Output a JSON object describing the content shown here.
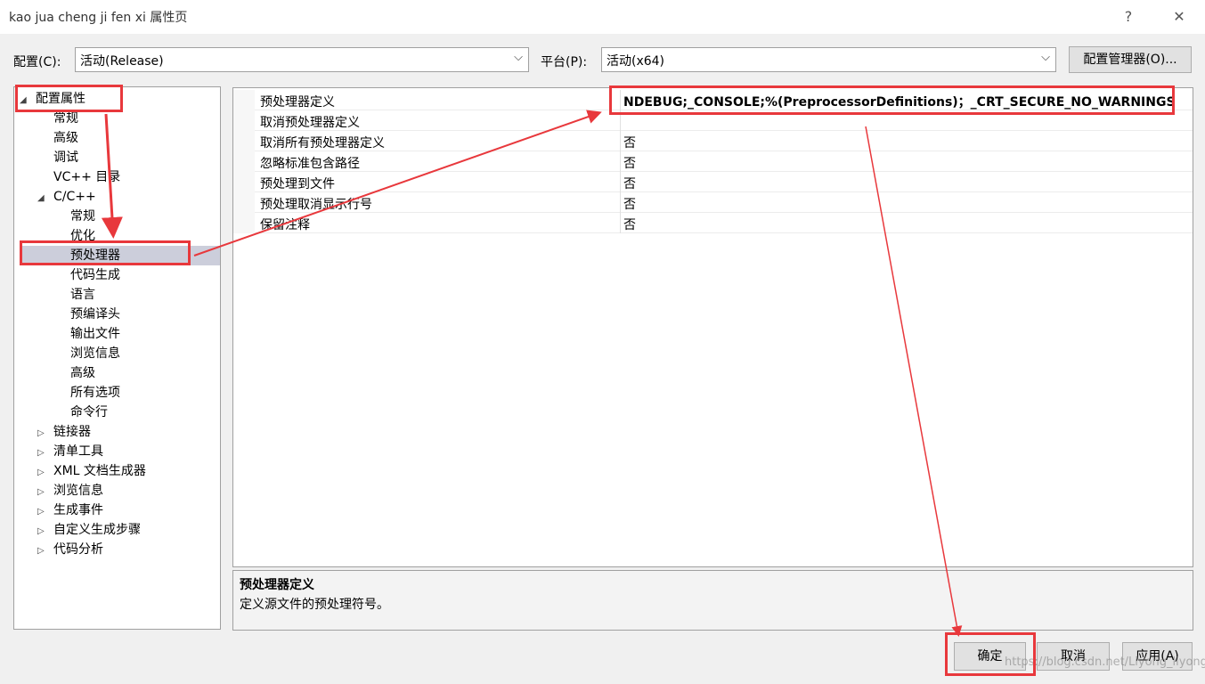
{
  "window": {
    "title": "kao jua cheng ji fen xi 属性页",
    "help": "?",
    "close": "✕"
  },
  "toolbar": {
    "config_label": "配置(C):",
    "config_value": "活动(Release)",
    "platform_label": "平台(P):",
    "platform_value": "活动(x64)",
    "config_manager": "配置管理器(O)..."
  },
  "tree": {
    "root": "配置属性",
    "general": "常规",
    "advanced": "高级",
    "debugging": "调试",
    "vc_dirs": "VC++ 目录",
    "cpp": "C/C++",
    "cpp_items": [
      "常规",
      "优化",
      "预处理器",
      "代码生成",
      "语言",
      "预编译头",
      "输出文件",
      "浏览信息",
      "高级",
      "所有选项",
      "命令行"
    ],
    "others": [
      "链接器",
      "清单工具",
      "XML 文档生成器",
      "浏览信息",
      "生成事件",
      "自定义生成步骤",
      "代码分析"
    ]
  },
  "props": [
    {
      "name": "预处理器定义",
      "value": "NDEBUG;_CONSOLE;%(PreprocessorDefinitions)；_CRT_SECURE_NO_WARNINGS"
    },
    {
      "name": "取消预处理器定义",
      "value": ""
    },
    {
      "name": "取消所有预处理器定义",
      "value": "否"
    },
    {
      "name": "忽略标准包含路径",
      "value": "否"
    },
    {
      "name": "预处理到文件",
      "value": "否"
    },
    {
      "name": "预处理取消显示行号",
      "value": "否"
    },
    {
      "name": "保留注释",
      "value": "否"
    }
  ],
  "description": {
    "title": "预处理器定义",
    "text": "定义源文件的预处理符号。"
  },
  "buttons": {
    "ok": "确定",
    "cancel": "取消",
    "apply": "应用(A)"
  },
  "watermark": "https://blog.csdn.net/Liyong_liyong",
  "colors": {
    "annotation": "#e8383c",
    "selection": "#cccedb"
  }
}
